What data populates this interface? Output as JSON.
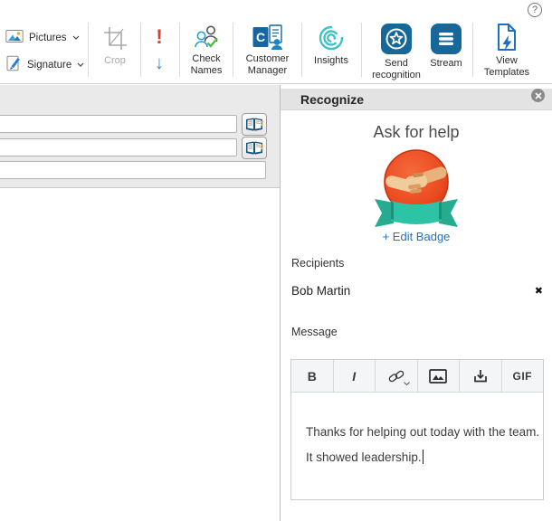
{
  "window": {
    "help_glyph": "?"
  },
  "ribbon": {
    "pictures_label": "Pictures",
    "signature_label": "Signature",
    "crop_label": "Crop",
    "high_importance_glyph": "!",
    "down_arrow_glyph": "↓",
    "check_names_label": "Check Names",
    "customer_manager_label": "Customer Manager",
    "insights_label": "Insights",
    "send_recognition_label": "Send recognition",
    "stream_label": "Stream",
    "view_templates_label": "View Templates"
  },
  "panel": {
    "title": "Recognize",
    "heading": "Ask for help",
    "edit_badge_link": "+ Edit Badge",
    "recipients_label": "Recipients",
    "recipients": [
      {
        "name": "Bob Martin",
        "remove_glyph": "✖"
      }
    ],
    "message_label": "Message",
    "toolbar": {
      "bold": "B",
      "italic": "I",
      "gif": "GIF"
    },
    "message": "Thanks for helping out today with the team. It showed leadership."
  },
  "colors": {
    "office_blue": "#16689a",
    "insights_teal": "#3fc1cc",
    "badge_red": "#e8481f",
    "ribbon_teal": "#2dc3a7",
    "link_blue": "#2173c2",
    "importance_red": "#d63e32",
    "arrow_blue": "#2e86d6"
  }
}
